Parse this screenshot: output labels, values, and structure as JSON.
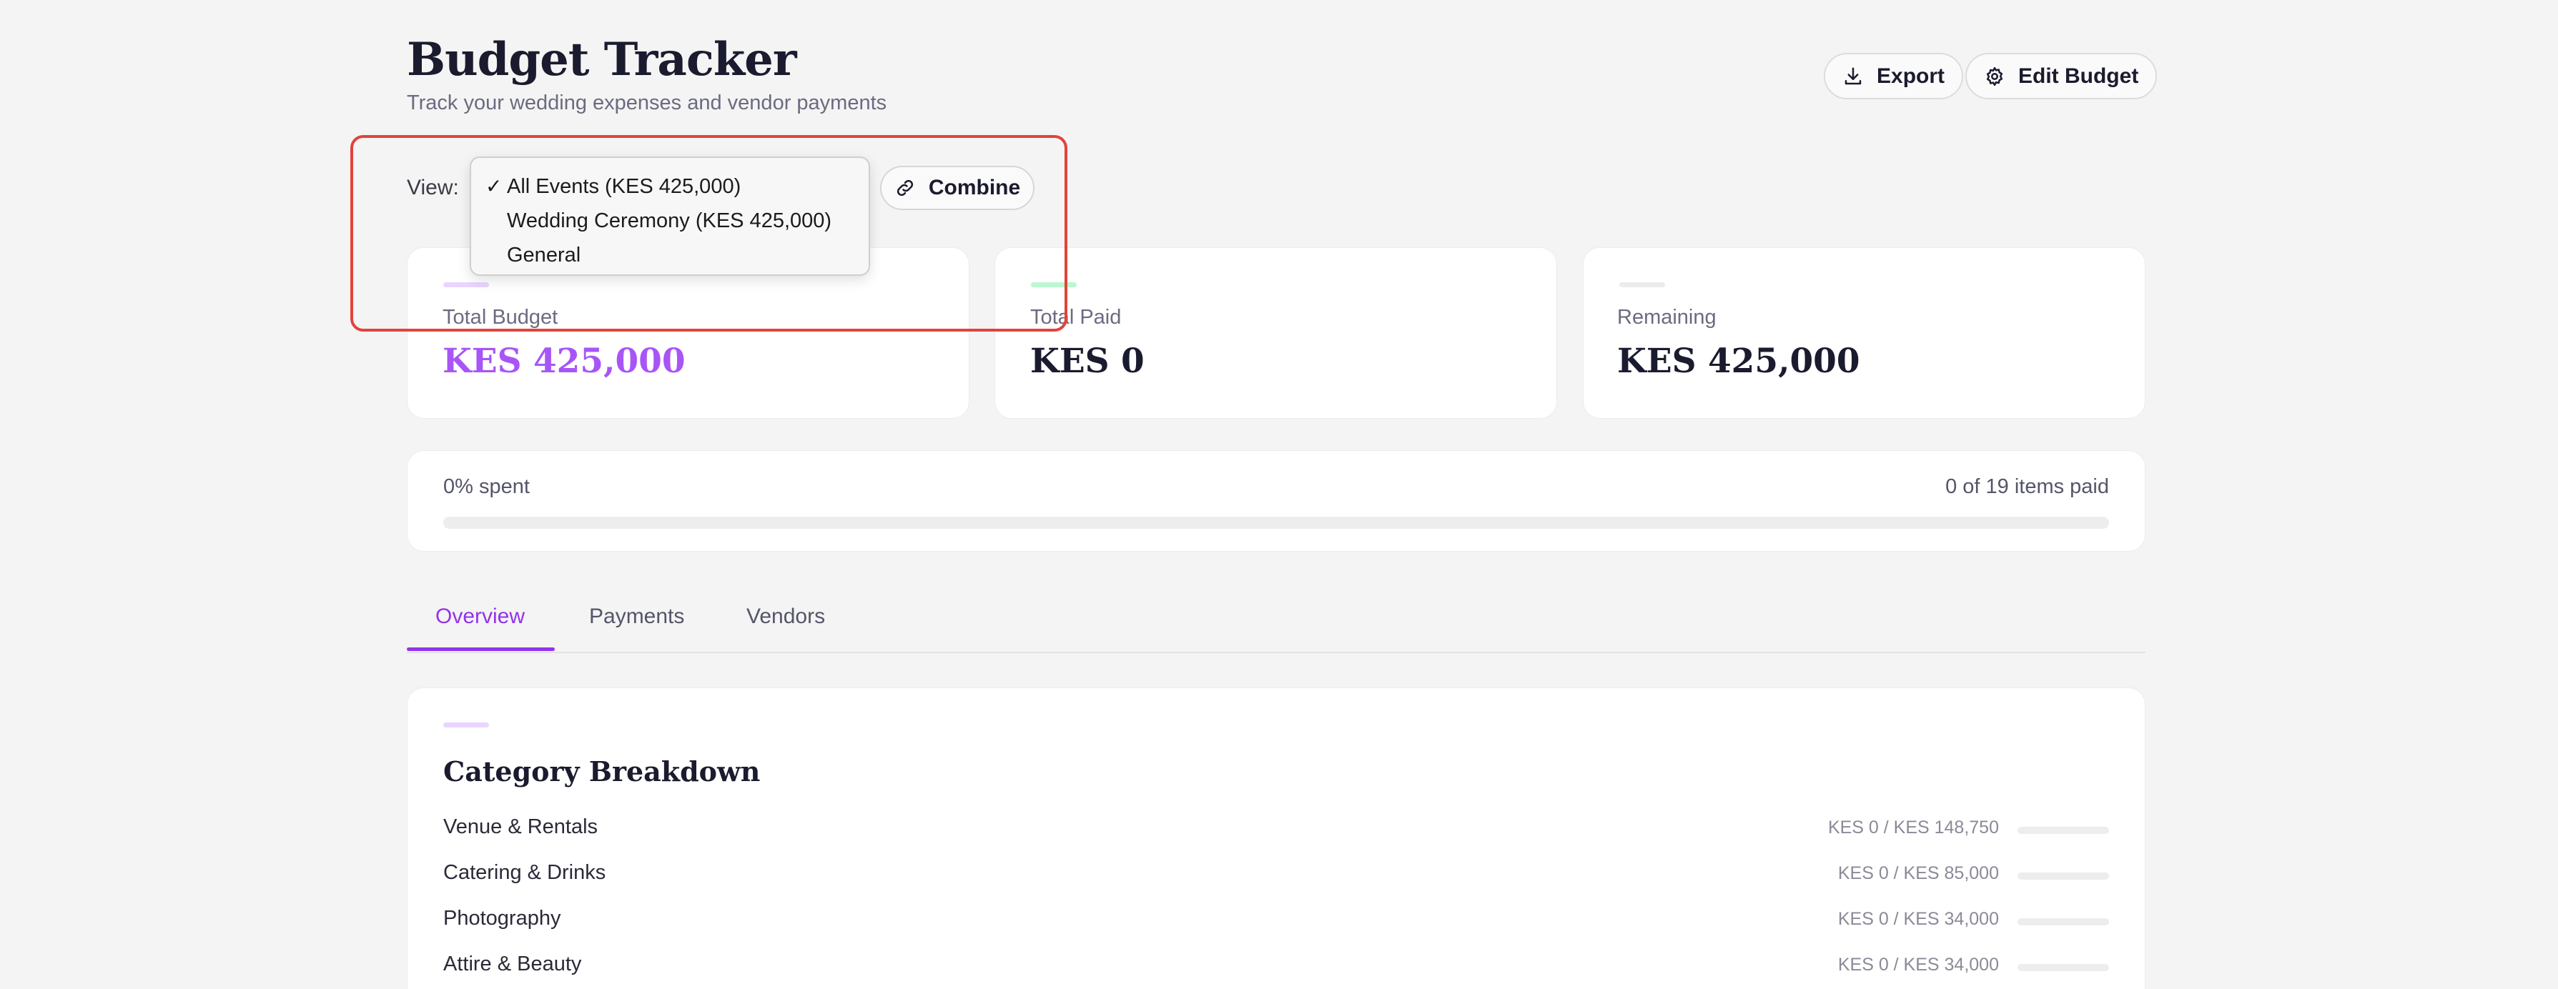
{
  "header": {
    "title": "Budget Tracker",
    "subtitle": "Track your wedding expenses and vendor payments",
    "export_label": "Export",
    "edit_label": "Edit Budget"
  },
  "view": {
    "label": "View:",
    "combine_label": "Combine",
    "dropdown": {
      "selected_index": 0,
      "options": [
        {
          "label": "All Events (KES 425,000)",
          "checked": true
        },
        {
          "label": "Wedding Ceremony (KES 425,000)",
          "checked": false
        },
        {
          "label": "General",
          "checked": false
        }
      ]
    }
  },
  "stats": [
    {
      "label": "Total Budget",
      "value": "KES 425,000",
      "value_color": "#a855f7",
      "accent_color": "#e9d5ff"
    },
    {
      "label": "Total Paid",
      "value": "KES 0",
      "value_color": "#1b1b2f",
      "accent_color": "#bbf7d0"
    },
    {
      "label": "Remaining",
      "value": "KES 425,000",
      "value_color": "#1b1b2f",
      "accent_color": "#ececec"
    }
  ],
  "progress": {
    "spent_text": "0% spent",
    "items_text": "0 of 19 items paid",
    "fraction": 0
  },
  "tabs": [
    {
      "label": "Overview",
      "active": true
    },
    {
      "label": "Payments",
      "active": false
    },
    {
      "label": "Vendors",
      "active": false
    }
  ],
  "category": {
    "title": "Category Breakdown",
    "rows": [
      {
        "name": "Venue & Rentals",
        "amount": "KES 0 / KES 148,750",
        "fraction": 0
      },
      {
        "name": "Catering & Drinks",
        "amount": "KES 0 / KES 85,000",
        "fraction": 0
      },
      {
        "name": "Photography",
        "amount": "KES 0 / KES 34,000",
        "fraction": 0
      },
      {
        "name": "Attire & Beauty",
        "amount": "KES 0 / KES 34,000",
        "fraction": 0
      }
    ]
  },
  "colors": {
    "accent": "#9333ea",
    "highlight_border": "#e0443a"
  },
  "icons": {
    "export": "download-icon",
    "edit": "gear-icon",
    "combine": "link-icon",
    "check": "checkmark-icon"
  }
}
